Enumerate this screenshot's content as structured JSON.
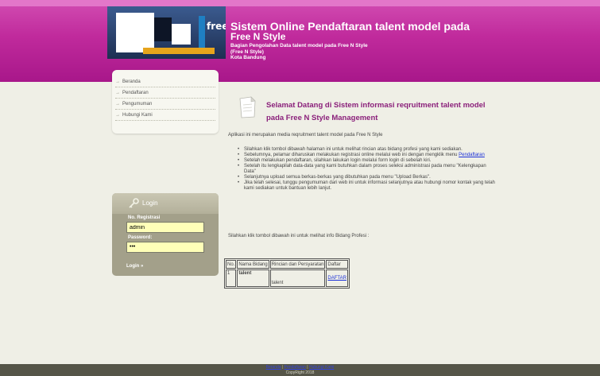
{
  "header": {
    "logo_text": "free",
    "title_line1": "Sistem Online Pendaftaran talent model pada",
    "title_line2": "Free N Style",
    "sub_line1": "Bagian Pengolahan Data talent model pada Free N Style",
    "sub_line2": "(Free N Style)",
    "sub_line3": "Kota Bandung"
  },
  "menu": {
    "items": [
      {
        "label": "Beranda"
      },
      {
        "label": "Pendaftaran"
      },
      {
        "label": "Pengumuman"
      },
      {
        "label": "Hubungi Kami"
      }
    ],
    "arrow": "→"
  },
  "login": {
    "title": "Login",
    "reg_label": "No. Registrasi",
    "reg_value": "admin",
    "pass_label": "Password:",
    "pass_value": "•••",
    "button": "Login",
    "button_arrow": "»"
  },
  "main": {
    "welcome_line1": "Selamat Datang di Sistem informasi reqruitment talent model",
    "welcome_line2": "pada Free N Style Management",
    "intro": "Aplikasi ini merupakan media reqruitment talent model pada Free N Style",
    "bullets": {
      "b1": "Silahkan klik tombol dibawah halaman ini untuk melihat rincian atas bidang profesi yang kami sediakan.",
      "b2_pre": "Sebelumnya, pelamar diharuskan melakukan registrasi online melalui web ini dengan mengklik menu",
      "b2_link": "Pendaftaran",
      "b3": "Setelah melakukan pendaftaran, silahkan lakukan login melalui form login di sebelah kiri.",
      "b4": "Setelah itu lengkapilah data-data yang kami butuhkan dalam proses seleksi administrasi pada menu \"Kelengkapan Data\"",
      "b5": "Selanjutnya upload semua berkas-berkas yang dibutuhkan pada menu \"Upload Berkas\".",
      "b6": "Jika telah selesai, tunggu pengumuman dari web ini untuk informasi selanjutnya atau hubungi nomor kontak yang telah kami sediakan untuk bantuan lebih lanjut."
    },
    "info2": "Silahkan klik tombol dibawah ini untuk melihat info Bidang Profesi :"
  },
  "table": {
    "headers": [
      "No.",
      "Nama Bidang",
      "Rincian dan Persyaratan",
      "Daftar"
    ],
    "row": {
      "no": "1",
      "nama": "talent",
      "rincian": "talent",
      "daftar": "DAFTAR"
    }
  },
  "footer": {
    "link1": "Beranda",
    "sep": "|",
    "link2": "Pendaftaran",
    "link3": "Hubungi Kami",
    "copyright": "CopyRight 2018"
  },
  "colors": {
    "header": "#c02a9c",
    "accent_text": "#8a1f7a",
    "link": "#1a2fd8",
    "input_bg": "#ffffb8"
  }
}
